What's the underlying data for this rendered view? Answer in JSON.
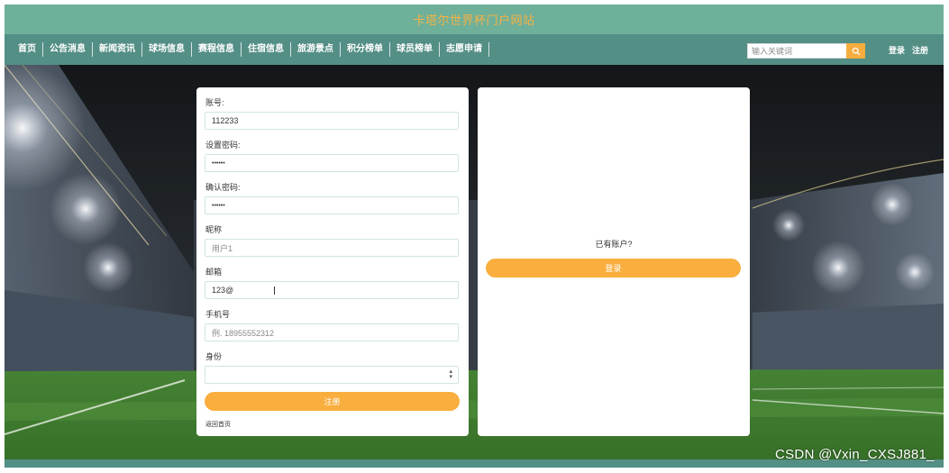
{
  "site": {
    "title": "卡塔尔世界杯门户网站"
  },
  "nav": {
    "items": [
      {
        "label": "首页"
      },
      {
        "label": "公告消息"
      },
      {
        "label": "新闻资讯"
      },
      {
        "label": "球场信息"
      },
      {
        "label": "赛程信息"
      },
      {
        "label": "住宿信息"
      },
      {
        "label": "旅游景点"
      },
      {
        "label": "积分榜单"
      },
      {
        "label": "球员榜单"
      },
      {
        "label": "志愿申请"
      }
    ],
    "search_placeholder": "输入关键词",
    "login": "登录",
    "register": "注册"
  },
  "form": {
    "account_label": "账号:",
    "account_value": "112233",
    "password_label": "设置密码:",
    "password_value": "••••••",
    "confirm_label": "确认密码:",
    "confirm_value": "••••••",
    "nickname_label": "昵称",
    "nickname_placeholder": "用户1",
    "email_label": "邮箱",
    "email_value": "123@",
    "phone_label": "手机号",
    "phone_placeholder": "例. 18955552312",
    "role_label": "身份",
    "role_value": "",
    "submit": "注册",
    "footer_link": "返回首页"
  },
  "side": {
    "have_account": "已有账户?",
    "login_button": "登录"
  },
  "watermark": "CSDN @Vxin_CXSJ881_",
  "colors": {
    "header": "#6fb09a",
    "nav": "#548f86",
    "accent": "#f9ae3d",
    "title_text": "#f5b244"
  }
}
